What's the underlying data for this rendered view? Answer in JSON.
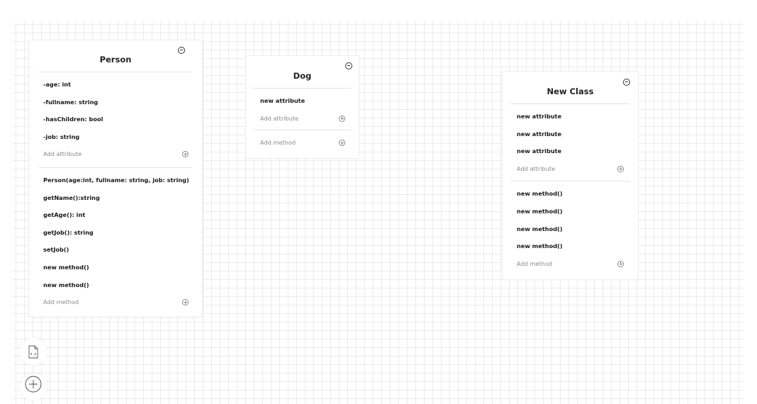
{
  "classes": [
    {
      "name": "Person",
      "attributes": [
        "-age: int",
        "-fullname: string",
        "-hasChildren: bool",
        "-job: string"
      ],
      "add_attribute_label": "Add attribute",
      "methods": [
        "Person(age:int, fullname: string, job: string)",
        "getName():string",
        "getAge(): int",
        "getJob(): string",
        "setJob()",
        "new method()",
        "new method()"
      ],
      "add_method_label": "Add method"
    },
    {
      "name": "Dog",
      "attributes": [
        "new attribute"
      ],
      "add_attribute_label": "Add attribute",
      "methods": [],
      "add_method_label": "Add method"
    },
    {
      "name": "New Class",
      "attributes": [
        "new attribute",
        "new attribute",
        "new attribute"
      ],
      "add_attribute_label": "Add attribute",
      "methods": [
        "new method()",
        "new method()",
        "new method()",
        "new method()"
      ],
      "add_method_label": "Add method"
    }
  ],
  "toolbar": {
    "export_icon": "file-code-icon",
    "add_icon": "plus-circle-icon"
  }
}
